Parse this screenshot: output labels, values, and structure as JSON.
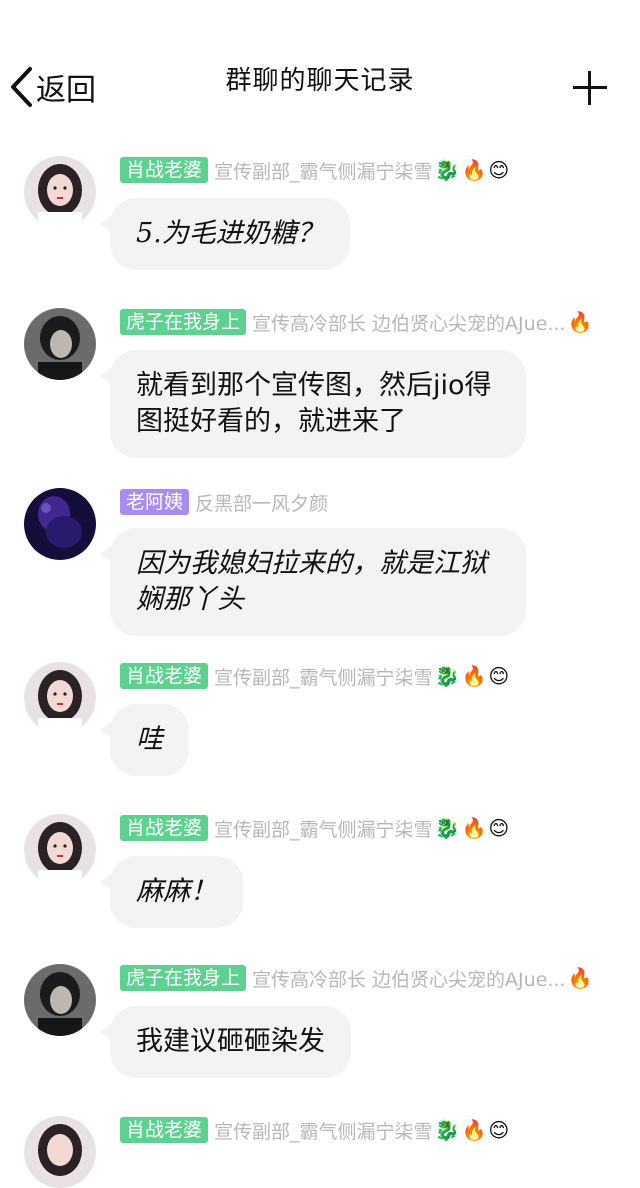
{
  "nav": {
    "back_label": "返回",
    "title": "群聊的聊天记录"
  },
  "messages": [
    {
      "badge": "肖战老婆",
      "badge_color": "green",
      "subtitle": "宣传副部_霸气侧漏宁柒雪",
      "emojis": [
        "🐉",
        "🔥",
        "😊"
      ],
      "text": "5.为毛进奶糖？",
      "avatar": "girl"
    },
    {
      "badge": "虎子在我身上",
      "badge_color": "green",
      "subtitle": "宣传高冷部长  边伯贤心尖宠的AJue...",
      "emojis": [
        "🔥"
      ],
      "text": "就看到那个宣传图，然后jio得图挺好看的，就进来了",
      "avatar": "boy"
    },
    {
      "badge": "老阿姨",
      "badge_color": "purple",
      "subtitle": "反黑部一风夕颜",
      "emojis": [],
      "text": "因为我媳妇拉来的，就是江狱娴那丫头",
      "avatar": "dark"
    },
    {
      "badge": "肖战老婆",
      "badge_color": "green",
      "subtitle": "宣传副部_霸气侧漏宁柒雪",
      "emojis": [
        "🐉",
        "🔥",
        "😊"
      ],
      "text": "哇",
      "avatar": "girl"
    },
    {
      "badge": "肖战老婆",
      "badge_color": "green",
      "subtitle": "宣传副部_霸气侧漏宁柒雪",
      "emojis": [
        "🐉",
        "🔥",
        "😊"
      ],
      "text": "麻麻！",
      "avatar": "girl"
    },
    {
      "badge": "虎子在我身上",
      "badge_color": "green",
      "subtitle": "宣传高冷部长  边伯贤心尖宠的AJue...",
      "emojis": [
        "🔥"
      ],
      "text": "我建议砸砸染发",
      "avatar": "boy"
    },
    {
      "badge": "肖战老婆",
      "badge_color": "green",
      "subtitle": "宣传副部_霸气侧漏宁柒雪",
      "emojis": [
        "🐉",
        "🔥",
        "😊"
      ],
      "text": "",
      "avatar": "girl"
    }
  ]
}
